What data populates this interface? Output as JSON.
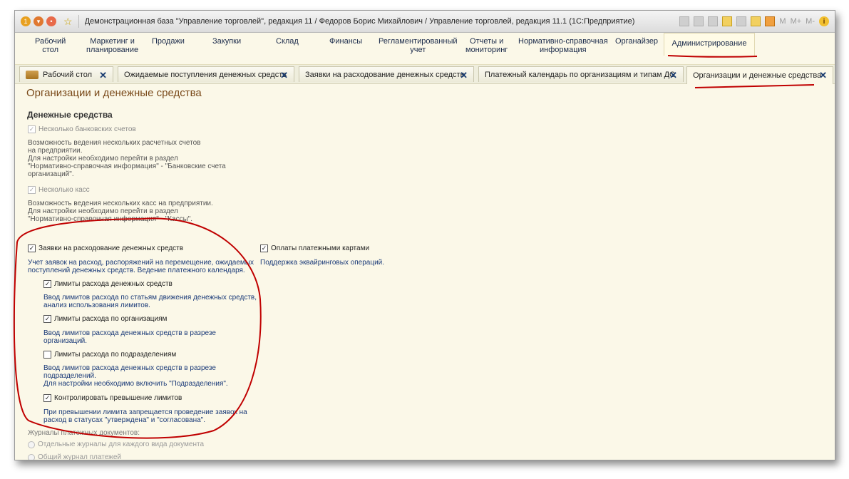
{
  "window": {
    "title": "Демонстрационная база \"Управление торговлей\", редакция 11 / Федоров Борис Михайлович / Управление торговлей, редакция 11.1  (1С:Предприятие)",
    "right_buttons": [
      "M",
      "M+",
      "M-"
    ]
  },
  "sections": [
    {
      "label": "Рабочий\nстол"
    },
    {
      "label": "Маркетинг и\nпланирование"
    },
    {
      "label": "Продажи"
    },
    {
      "label": "Закупки"
    },
    {
      "label": "Склад"
    },
    {
      "label": "Финансы"
    },
    {
      "label": "Регламентированный\nучет"
    },
    {
      "label": "Отчеты и\nмониторинг"
    },
    {
      "label": "Нормативно-справочная\nинформация"
    },
    {
      "label": "Органайзер"
    },
    {
      "label": "Администрирование"
    }
  ],
  "tabs": [
    {
      "label": "Рабочий стол"
    },
    {
      "label": "Ожидаемые поступления денежных средств"
    },
    {
      "label": "Заявки на расходование денежных средств"
    },
    {
      "label": "Платежный календарь по организациям и типам ДС"
    },
    {
      "label": "Организации и денежные средства"
    }
  ],
  "close_glyph": "✕",
  "page": {
    "title": "Организации и денежные средства",
    "group_title": "Денежные средства",
    "bank_accounts": {
      "label": "Несколько банковских счетов",
      "checked": true,
      "desc": "Возможность ведения нескольких расчетных счетов\nна предприятии.\nДля настройки необходимо перейти в раздел\n\"Нормативно-справочная информация\" - \"Банковские счета\nорганизаций\"."
    },
    "cash_desks": {
      "label": "Несколько касс",
      "checked": true,
      "desc": "Возможность ведения нескольких касс на предприятии.\nДля настройки необходимо перейти в раздел\n\"Нормативно-справочная информация\" - \"Кассы\"."
    },
    "requests": {
      "label": "Заявки на расходование денежных средств",
      "checked": true,
      "desc": "Учет заявок на расход, распоряжений на перемещение, ожидаемых\nпоступлений денежных средств. Ведение платежного календаря."
    },
    "card_payments": {
      "label": "Оплаты платежными картами",
      "checked": true,
      "desc": "Поддержка эквайринговых операций."
    },
    "limits_dds": {
      "label": "Лимиты расхода денежных средств",
      "checked": true,
      "desc": "Ввод лимитов расхода по статьям движения денежных средств,\nанализ использования лимитов."
    },
    "limits_orgs": {
      "label": "Лимиты расхода по организациям",
      "checked": true,
      "desc": "Ввод лимитов расхода денежных средств в разрезе\nорганизаций."
    },
    "limits_depts": {
      "label": "Лимиты расхода по подразделениям",
      "checked": false,
      "desc": "Ввод лимитов расхода денежных средств в разрезе\nподразделений.\nДля настройки необходимо включить \"Подразделения\"."
    },
    "control_limits": {
      "label": "Контролировать превышение лимитов",
      "checked": true,
      "desc": "При превышении лимита запрещается проведение заявок на\nрасход в статусах \"утверждена\" и \"согласована\"."
    },
    "journals_label": "Журналы платежных документов:",
    "journal_options": [
      "Отдельные журналы для каждого вида документа",
      "Общий журнал платежей"
    ]
  },
  "colors": {
    "annotation": "#c00000",
    "accent_text": "#7a4a1a",
    "link_text": "#1a3a78"
  }
}
